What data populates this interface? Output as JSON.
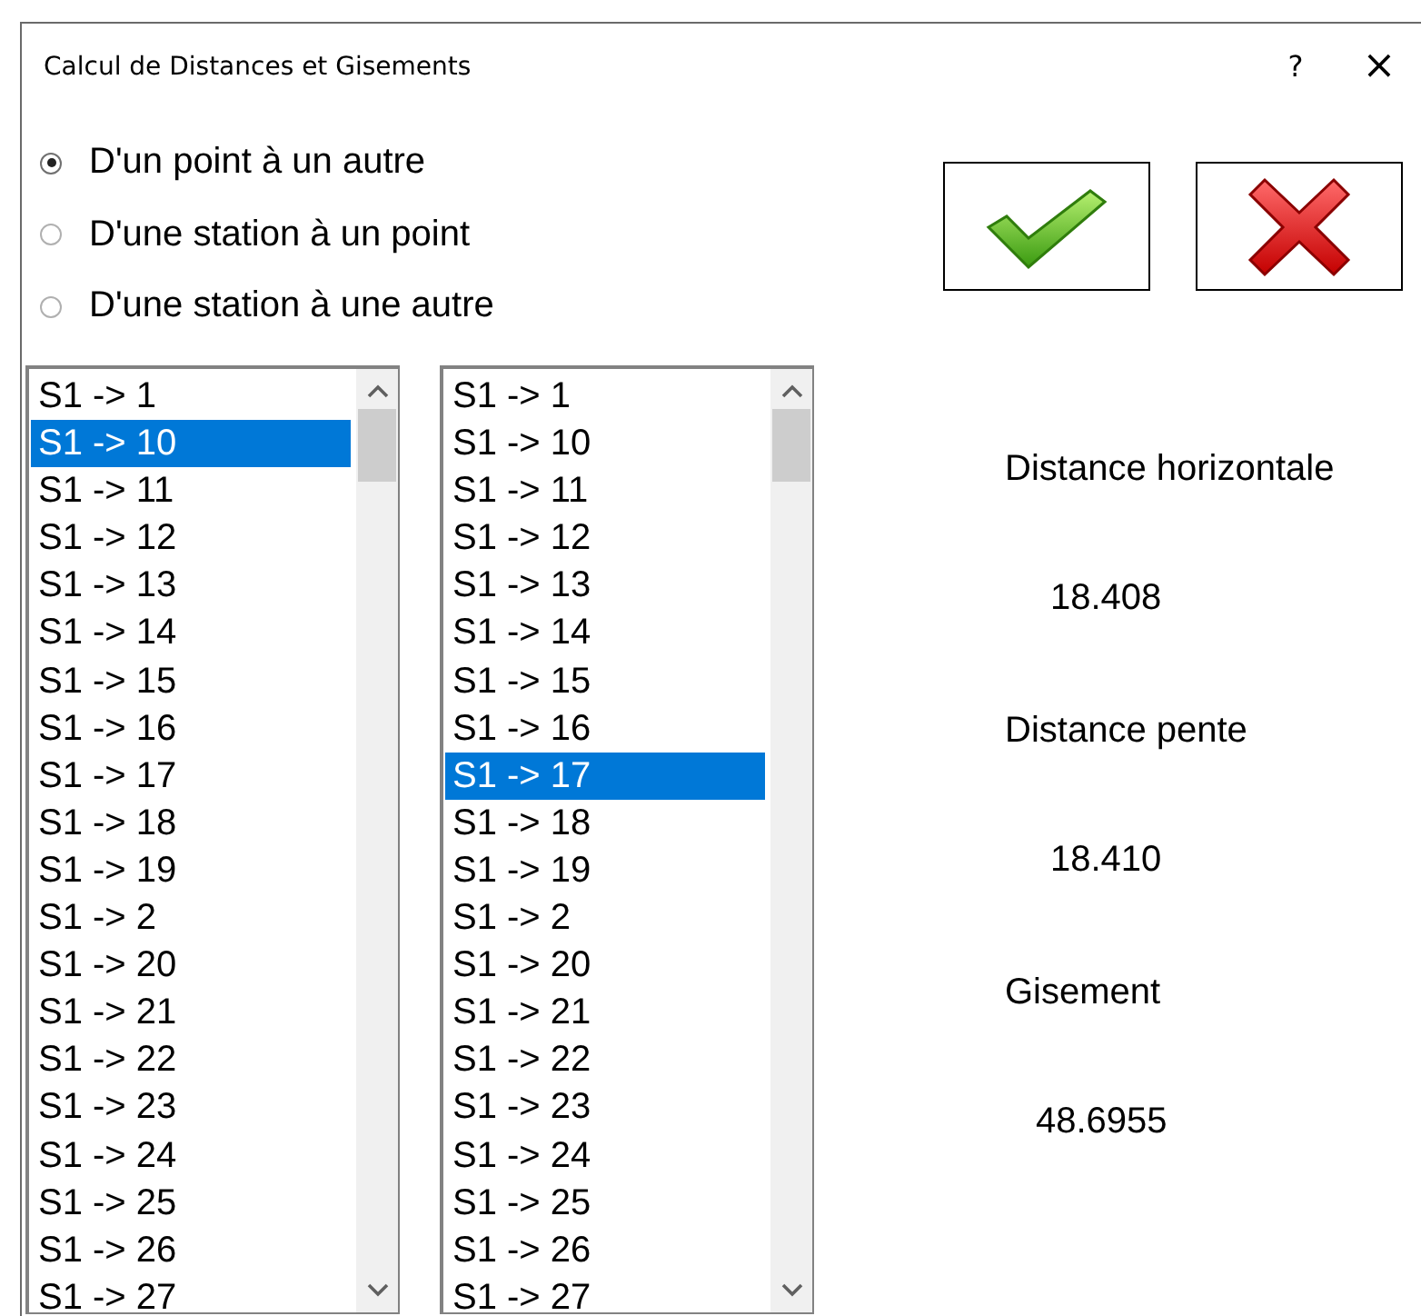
{
  "window": {
    "title": "Calcul de Distances et Gisements",
    "help": "?",
    "close": "×"
  },
  "mode_options": [
    {
      "label": "D'un point à un autre",
      "selected": true
    },
    {
      "label": "D'une station à un point",
      "selected": false
    },
    {
      "label": "D'une station à une autre",
      "selected": false
    }
  ],
  "buttons": [
    {
      "kind": "ok"
    },
    {
      "kind": "cancel"
    }
  ],
  "lists": [
    {
      "items": [
        {
          "label": "S1 -> 1",
          "selected": false
        },
        {
          "label": "S1 -> 10",
          "selected": true
        },
        {
          "label": "S1 -> 11",
          "selected": false
        },
        {
          "label": "S1 -> 12",
          "selected": false
        },
        {
          "label": "S1 -> 13",
          "selected": false
        },
        {
          "label": "S1 -> 14",
          "selected": false
        },
        {
          "label": "S1 -> 15",
          "selected": false
        },
        {
          "label": "S1 -> 16",
          "selected": false
        },
        {
          "label": "S1 -> 17",
          "selected": false
        },
        {
          "label": "S1 -> 18",
          "selected": false
        },
        {
          "label": "S1 -> 19",
          "selected": false
        },
        {
          "label": "S1 -> 2",
          "selected": false
        },
        {
          "label": "S1 -> 20",
          "selected": false
        },
        {
          "label": "S1 -> 21",
          "selected": false
        },
        {
          "label": "S1 -> 22",
          "selected": false
        },
        {
          "label": "S1 -> 23",
          "selected": false
        },
        {
          "label": "S1 -> 24",
          "selected": false
        },
        {
          "label": "S1 -> 25",
          "selected": false
        },
        {
          "label": "S1 -> 26",
          "selected": false
        },
        {
          "label": "S1 -> 27",
          "selected": false
        }
      ]
    },
    {
      "items": [
        {
          "label": "S1 -> 1",
          "selected": false
        },
        {
          "label": "S1 -> 10",
          "selected": false
        },
        {
          "label": "S1 -> 11",
          "selected": false
        },
        {
          "label": "S1 -> 12",
          "selected": false
        },
        {
          "label": "S1 -> 13",
          "selected": false
        },
        {
          "label": "S1 -> 14",
          "selected": false
        },
        {
          "label": "S1 -> 15",
          "selected": false
        },
        {
          "label": "S1 -> 16",
          "selected": false
        },
        {
          "label": "S1 -> 17",
          "selected": true
        },
        {
          "label": "S1 -> 18",
          "selected": false
        },
        {
          "label": "S1 -> 19",
          "selected": false
        },
        {
          "label": "S1 -> 2",
          "selected": false
        },
        {
          "label": "S1 -> 20",
          "selected": false
        },
        {
          "label": "S1 -> 21",
          "selected": false
        },
        {
          "label": "S1 -> 22",
          "selected": false
        },
        {
          "label": "S1 -> 23",
          "selected": false
        },
        {
          "label": "S1 -> 24",
          "selected": false
        },
        {
          "label": "S1 -> 25",
          "selected": false
        },
        {
          "label": "S1 -> 26",
          "selected": false
        },
        {
          "label": "S1 -> 27",
          "selected": false
        }
      ]
    }
  ],
  "results": [
    {
      "label": "Distance horizontale",
      "value": "18.408"
    },
    {
      "label": "Distance pente",
      "value": "18.410"
    },
    {
      "label": "Gisement",
      "value": "48.6955"
    }
  ]
}
